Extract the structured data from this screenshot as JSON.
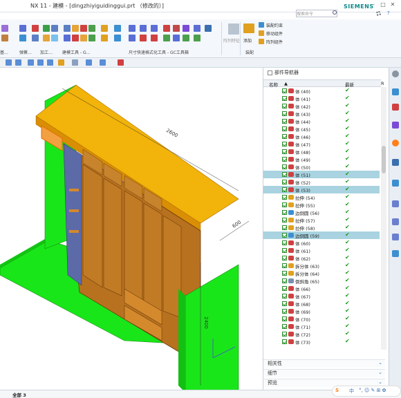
{
  "titlebar": {
    "title": "NX 11 - 建模 - [dingzhiyiguidinggui.prt （修改的）]",
    "search_placeholder": "搜索命令",
    "brand": "SIEMENS"
  },
  "ribbon": {
    "groups": [
      {
        "label": "基…"
      },
      {
        "label": "弹簧…"
      },
      {
        "label": "加工…"
      },
      {
        "label": "建模工具 - G…"
      },
      {
        "label": "尺寸快速格式化工具 - GC工具箱"
      },
      {
        "label": "装配"
      }
    ],
    "pattern_label": "阵列特征",
    "add_label": "添加",
    "assembly_constraint": "装配约束",
    "move_component": "移动组件",
    "array_component": "阵列组件"
  },
  "drawing": {
    "dim_length": "2600",
    "dim_depth": "600",
    "dim_height": "2400"
  },
  "navigator": {
    "title": "部件导航器",
    "col_name": "名称",
    "col_latest": "最新",
    "col_r": "R",
    "rows": [
      {
        "label": "体 (40)",
        "icon": "body",
        "sel": false
      },
      {
        "label": "体 (41)",
        "icon": "body",
        "sel": false
      },
      {
        "label": "体 (42)",
        "icon": "body",
        "sel": false
      },
      {
        "label": "体 (43)",
        "icon": "body",
        "sel": false
      },
      {
        "label": "体 (44)",
        "icon": "body",
        "sel": false
      },
      {
        "label": "体 (45)",
        "icon": "body",
        "sel": false
      },
      {
        "label": "体 (46)",
        "icon": "body",
        "sel": false
      },
      {
        "label": "体 (47)",
        "icon": "body",
        "sel": false
      },
      {
        "label": "体 (48)",
        "icon": "body",
        "sel": false
      },
      {
        "label": "体 (49)",
        "icon": "body",
        "sel": false
      },
      {
        "label": "体 (50)",
        "icon": "body",
        "sel": false
      },
      {
        "label": "体 (51)",
        "icon": "body",
        "sel": true
      },
      {
        "label": "体 (52)",
        "icon": "body",
        "sel": false
      },
      {
        "label": "体 (53)",
        "icon": "body",
        "sel": true
      },
      {
        "label": "拉伸 (54)",
        "icon": "extrude",
        "sel": false
      },
      {
        "label": "拉伸 (55)",
        "icon": "extrude",
        "sel": false
      },
      {
        "label": "边倒圆 (56)",
        "icon": "blend",
        "sel": false
      },
      {
        "label": "拉伸 (57)",
        "icon": "extrude",
        "sel": false
      },
      {
        "label": "拉伸 (58)",
        "icon": "extrude",
        "sel": false
      },
      {
        "label": "边倒圆 (59)",
        "icon": "blend",
        "sel": true
      },
      {
        "label": "体 (60)",
        "icon": "body",
        "sel": false
      },
      {
        "label": "体 (61)",
        "icon": "body",
        "sel": false
      },
      {
        "label": "体 (62)",
        "icon": "body",
        "sel": false
      },
      {
        "label": "拆分体 (63)",
        "icon": "split",
        "sel": false
      },
      {
        "label": "拆分体 (64)",
        "icon": "split",
        "sel": false
      },
      {
        "label": "倒斜角 (65)",
        "icon": "chamfer",
        "sel": false
      },
      {
        "label": "体 (66)",
        "icon": "body",
        "sel": false
      },
      {
        "label": "体 (67)",
        "icon": "body",
        "sel": false
      },
      {
        "label": "体 (68)",
        "icon": "body",
        "sel": false
      },
      {
        "label": "体 (69)",
        "icon": "body",
        "sel": false
      },
      {
        "label": "体 (70)",
        "icon": "body",
        "sel": false
      },
      {
        "label": "体 (71)",
        "icon": "body",
        "sel": false
      },
      {
        "label": "体 (72)",
        "icon": "body",
        "sel": false
      },
      {
        "label": "体 (73)",
        "icon": "body",
        "sel": false
      }
    ],
    "sections": [
      "相关性",
      "细节",
      "预览"
    ]
  },
  "status": {
    "text": "全部 3"
  },
  "ime": {
    "lang": "中",
    "symbols": "°, ☺ ✎ ⊞ ✿"
  },
  "colors": {
    "green_panel": "#19e619",
    "wood": "#b8711f",
    "yellow_top": "#f2b30a",
    "selected_row": "#a9d3e0",
    "check_green": "#1a9a1a"
  }
}
